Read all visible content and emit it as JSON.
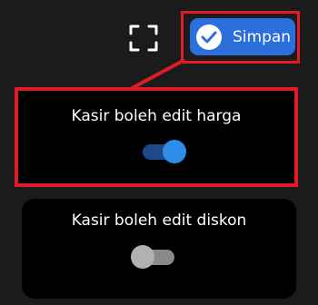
{
  "toolbar": {
    "save_label": "Simpan",
    "accent_color": "#2a6fdc",
    "highlight_color": "#e01b24"
  },
  "settings": [
    {
      "label": "Kasir boleh edit harga",
      "enabled": true
    },
    {
      "label": "Kasir boleh edit diskon",
      "enabled": false
    }
  ]
}
